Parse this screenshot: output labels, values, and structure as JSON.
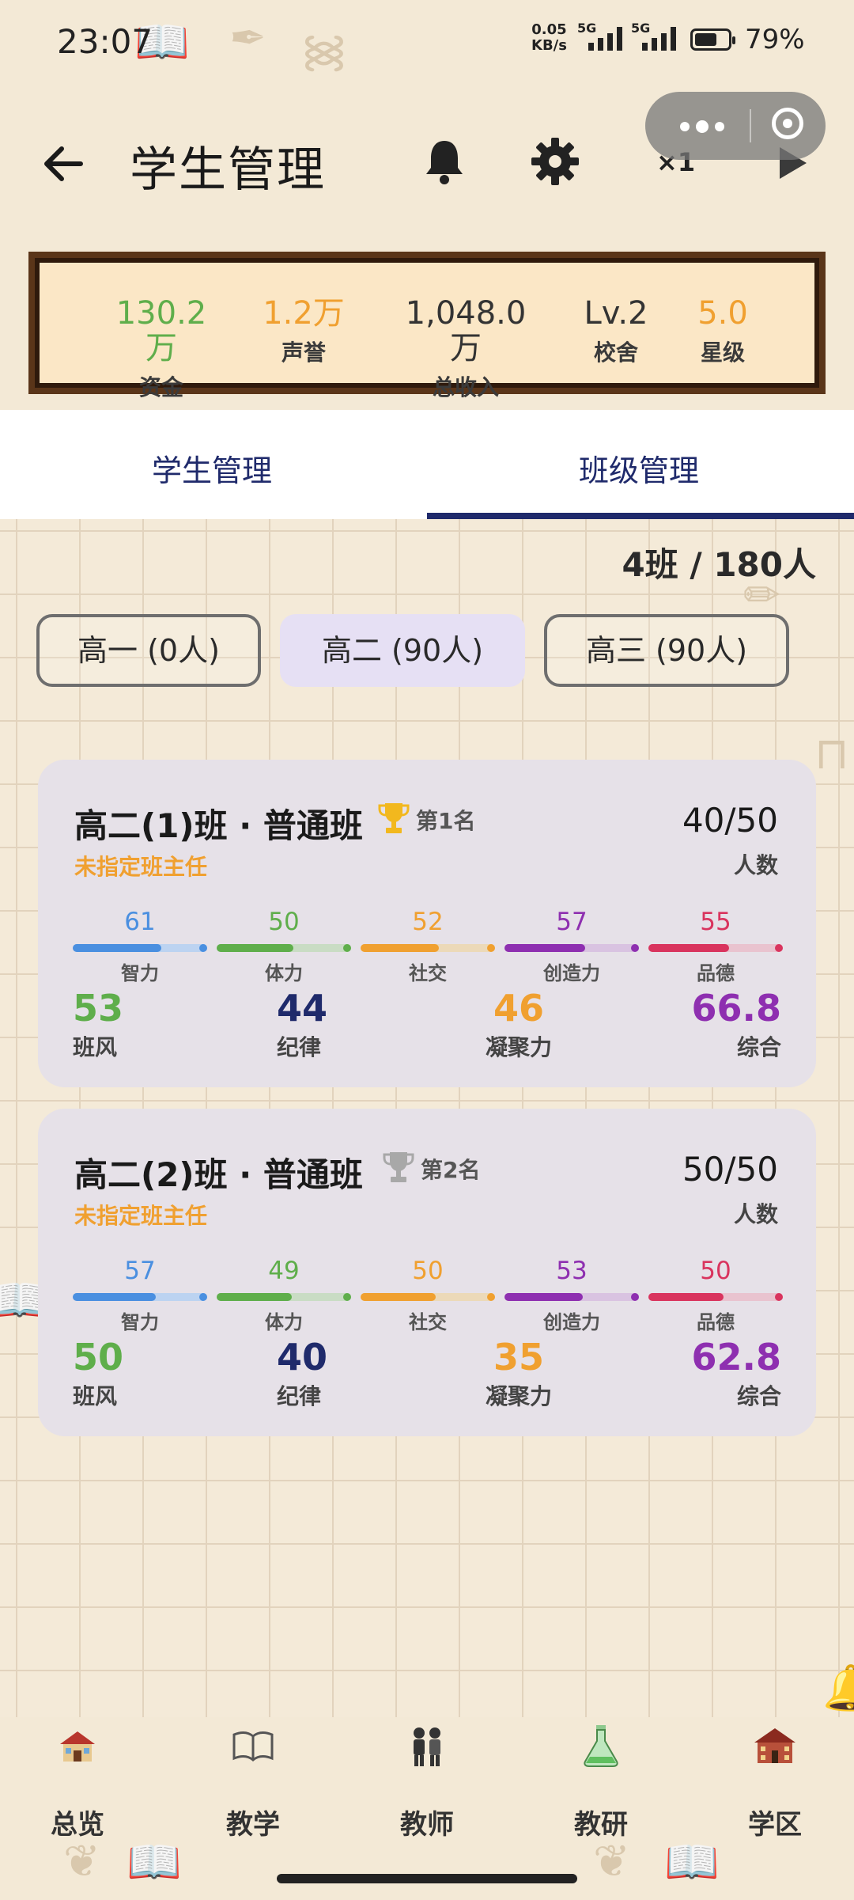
{
  "status_bar": {
    "time": "23:07",
    "net_speed_value": "0.05",
    "net_speed_unit": "KB/s",
    "sim1": "5G",
    "sim2": "5G",
    "battery_pct": "79%",
    "battery_level": 0.79
  },
  "header": {
    "title": "学生管理",
    "speed": "×1"
  },
  "resources": [
    {
      "value": "130.2万",
      "label": "资金",
      "color": "#5fae4b"
    },
    {
      "value": "1.2万",
      "label": "声誉",
      "color": "#f0a030"
    },
    {
      "value": "1,048.0万",
      "label": "总收入",
      "color": "#333333"
    },
    {
      "value": "Lv.2",
      "label": "校舍",
      "color": "#333333"
    },
    {
      "value": "5.0",
      "label": "星级",
      "color": "#f0a030"
    }
  ],
  "tabs": {
    "student": "学生管理",
    "class": "班级管理"
  },
  "summary": "4班 / 180人",
  "grades": [
    {
      "label": "高一 (0人)"
    },
    {
      "label": "高二 (90人)"
    },
    {
      "label": "高三 (90人)"
    }
  ],
  "attr_labels": [
    "智力",
    "体力",
    "社交",
    "创造力",
    "品德"
  ],
  "attr_colors": [
    "#4a8fe0",
    "#5fae4b",
    "#f0a030",
    "#8e2fb0",
    "#d9345e"
  ],
  "classes": [
    {
      "name": "高二(1)班 · 普通班",
      "rank": "第1名",
      "count": "40/50",
      "count_label": "人数",
      "teacher": "未指定班主任",
      "attrs": [
        61,
        50,
        52,
        57,
        55
      ],
      "fills": [
        0.66,
        0.57,
        0.58,
        0.6,
        0.6
      ],
      "stats": {
        "class_style": "53",
        "discipline": "44",
        "cohesion": "46",
        "overall": "66.8"
      },
      "stat_labels": {
        "class_style": "班风",
        "discipline": "纪律",
        "cohesion": "凝聚力",
        "overall": "综合"
      }
    },
    {
      "name": "高二(2)班 · 普通班",
      "rank": "第2名",
      "count": "50/50",
      "count_label": "人数",
      "teacher": "未指定班主任",
      "attrs": [
        57,
        49,
        50,
        53,
        50
      ],
      "fills": [
        0.62,
        0.56,
        0.56,
        0.58,
        0.56
      ],
      "stats": {
        "class_style": "50",
        "discipline": "40",
        "cohesion": "35",
        "overall": "62.8"
      },
      "stat_labels": {
        "class_style": "班风",
        "discipline": "纪律",
        "cohesion": "凝聚力",
        "overall": "综合"
      }
    }
  ],
  "bottom_nav": [
    {
      "label": "总览",
      "icon": "school-icon"
    },
    {
      "label": "教学",
      "icon": "book-icon"
    },
    {
      "label": "教师",
      "icon": "teachers-icon"
    },
    {
      "label": "教研",
      "icon": "flask-icon"
    },
    {
      "label": "学区",
      "icon": "district-icon"
    }
  ]
}
